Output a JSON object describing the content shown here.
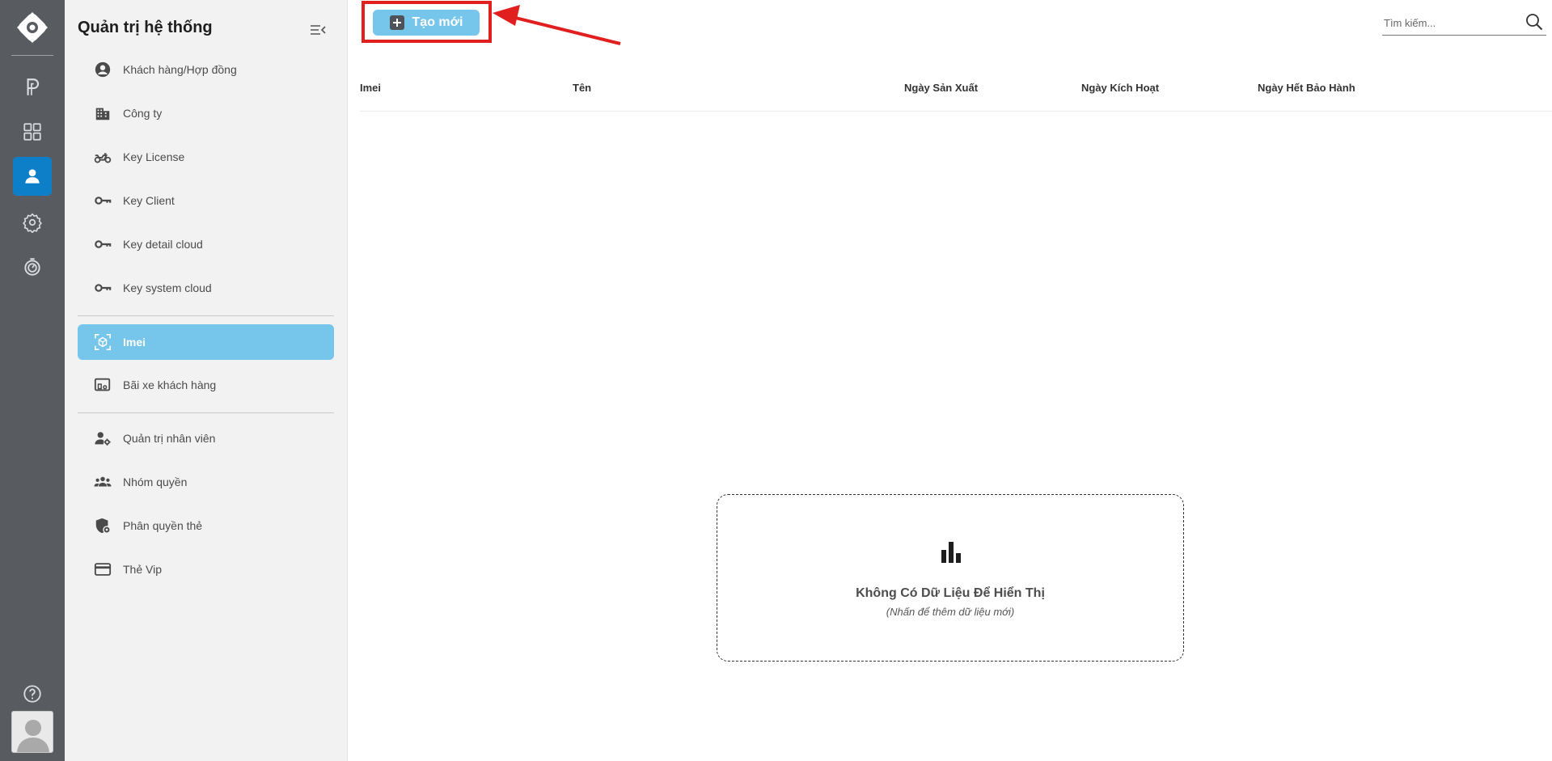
{
  "rail": {
    "items": [
      {
        "icon": "parking-icon"
      },
      {
        "icon": "grid-icon"
      },
      {
        "icon": "user-icon",
        "active": true
      },
      {
        "icon": "gear-icon"
      },
      {
        "icon": "timer-icon"
      }
    ],
    "help_icon": "help-icon",
    "avatar_icon": "avatar-icon"
  },
  "sidebar": {
    "title": "Quản trị hệ thống",
    "items": [
      {
        "label": "Khách hàng/Hợp đồng",
        "icon": "account-circle-icon"
      },
      {
        "label": "Công ty",
        "icon": "building-icon"
      },
      {
        "label": "Key License",
        "icon": "motorbike-icon"
      },
      {
        "label": "Key Client",
        "icon": "key-icon"
      },
      {
        "label": "Key detail cloud",
        "icon": "key-icon"
      },
      {
        "label": "Key system cloud",
        "icon": "key-icon"
      },
      {
        "label": "Imei",
        "icon": "cube-scan-icon",
        "active": true
      },
      {
        "label": "Bãi xe khách hàng",
        "icon": "devices-icon"
      },
      {
        "label": "Quản trị nhân viên",
        "icon": "user-cog-icon"
      },
      {
        "label": "Nhóm quyền",
        "icon": "group-icon"
      },
      {
        "label": "Phân quyền thẻ",
        "icon": "shield-lock-icon"
      },
      {
        "label": "Thẻ Vip",
        "icon": "credit-card-icon"
      }
    ]
  },
  "toolbar": {
    "create_label": "Tạo mới"
  },
  "search": {
    "placeholder": "Tìm kiếm..."
  },
  "table": {
    "columns": [
      "Imei",
      "Tên",
      "Ngày Sản Xuất",
      "Ngày Kích Hoạt",
      "Ngày Hết Bảo Hành"
    ]
  },
  "empty_state": {
    "title": "Không Có Dữ Liệu Để Hiển Thị",
    "subtitle": "(Nhấn để thêm dữ liệu mới)"
  },
  "colors": {
    "rail_bg": "#585c61",
    "rail_active": "#0d7fc8",
    "accent": "#76c5eb",
    "annotation": "#e21f1f"
  }
}
